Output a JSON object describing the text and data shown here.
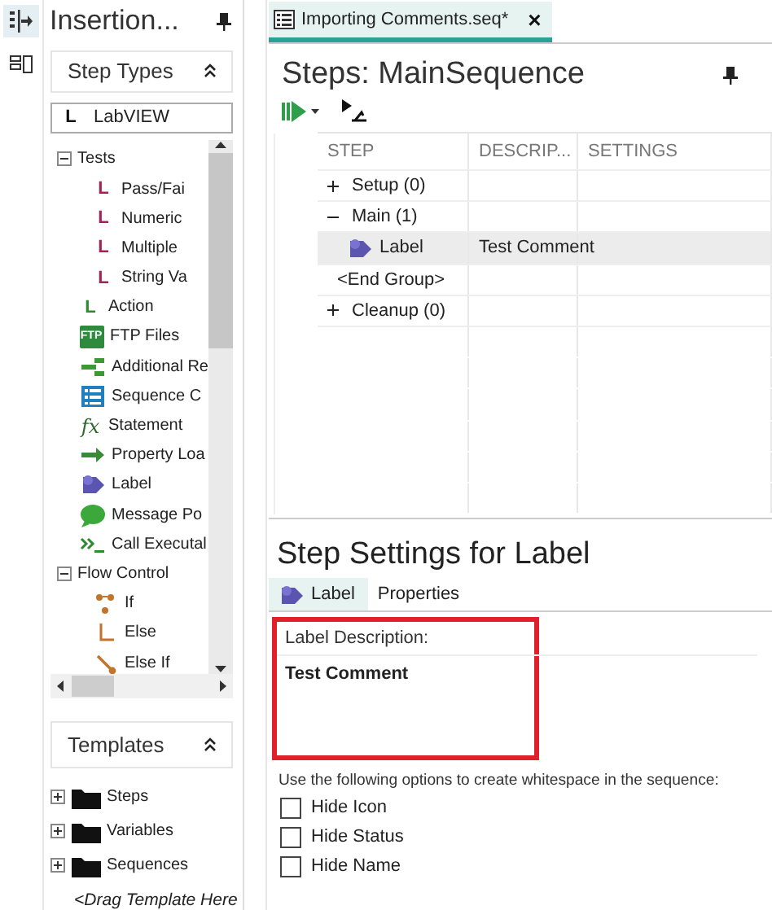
{
  "insertion_palette": {
    "title": "Insertion...",
    "step_types": {
      "title": "Step Types",
      "adapter": {
        "glyph": "L",
        "value": "LabVIEW"
      },
      "tree": [
        {
          "label": "Tests",
          "kind": "group",
          "expanded": true,
          "children": [
            {
              "label": "Pass/Fai",
              "kind": "labview",
              "glyph": "L"
            },
            {
              "label": "Numeric",
              "kind": "labview",
              "glyph": "L"
            },
            {
              "label": "Multiple",
              "kind": "labview",
              "glyph": "L"
            },
            {
              "label": "String Va",
              "kind": "labview",
              "glyph": "L"
            }
          ]
        },
        {
          "label": "Action",
          "kind": "action",
          "glyph": "L"
        },
        {
          "label": "FTP Files",
          "kind": "ftp",
          "glyph": "FTP"
        },
        {
          "label": "Additional Re",
          "kind": "additional"
        },
        {
          "label": "Sequence C",
          "kind": "sequence-call"
        },
        {
          "label": "Statement",
          "kind": "statement",
          "glyph": "fx"
        },
        {
          "label": "Property Loa",
          "kind": "property"
        },
        {
          "label": "Label",
          "kind": "label"
        },
        {
          "label": "Message Po",
          "kind": "message"
        },
        {
          "label": "Call Executal",
          "kind": "call-exe"
        },
        {
          "label": "Flow Control",
          "kind": "group",
          "expanded": true,
          "children": [
            {
              "label": "If",
              "kind": "if"
            },
            {
              "label": "Else",
              "kind": "else"
            },
            {
              "label": "Else If",
              "kind": "elseif"
            }
          ]
        }
      ]
    },
    "templates": {
      "title": "Templates",
      "items": [
        {
          "label": "Steps",
          "expanded": false
        },
        {
          "label": "Variables",
          "expanded": false
        },
        {
          "label": "Sequences",
          "expanded": false
        }
      ],
      "drop_hint": "<Drag Template Here"
    }
  },
  "document_tab": {
    "title": "Importing Comments.seq*",
    "close": "×"
  },
  "steps": {
    "title": "Steps: MainSequence",
    "columns": [
      "STEP",
      "DESCRIP...",
      "SETTINGS"
    ],
    "rows": [
      {
        "kind": "group",
        "step": "Setup (0)",
        "expanded": false,
        "selected": false
      },
      {
        "kind": "group",
        "step": "Main (1)",
        "expanded": true,
        "selected": false
      },
      {
        "kind": "label",
        "step": "Label",
        "description": "Test Comment",
        "selected": true
      },
      {
        "kind": "end",
        "step": "<End Group>",
        "selected": false
      },
      {
        "kind": "group",
        "step": "Cleanup (0)",
        "expanded": false,
        "selected": false
      }
    ]
  },
  "step_settings": {
    "title": "Step Settings for Label",
    "tabs": [
      {
        "label": "Label",
        "selected": true
      },
      {
        "label": "Properties",
        "selected": false
      }
    ],
    "description_label": "Label Description:",
    "description": "Test Comment",
    "hint": "Use the following options to create whitespace in the sequence:",
    "options": [
      {
        "label": "Hide Icon",
        "checked": false
      },
      {
        "label": "Hide Status",
        "checked": false
      },
      {
        "label": "Hide Name",
        "checked": false
      }
    ]
  }
}
